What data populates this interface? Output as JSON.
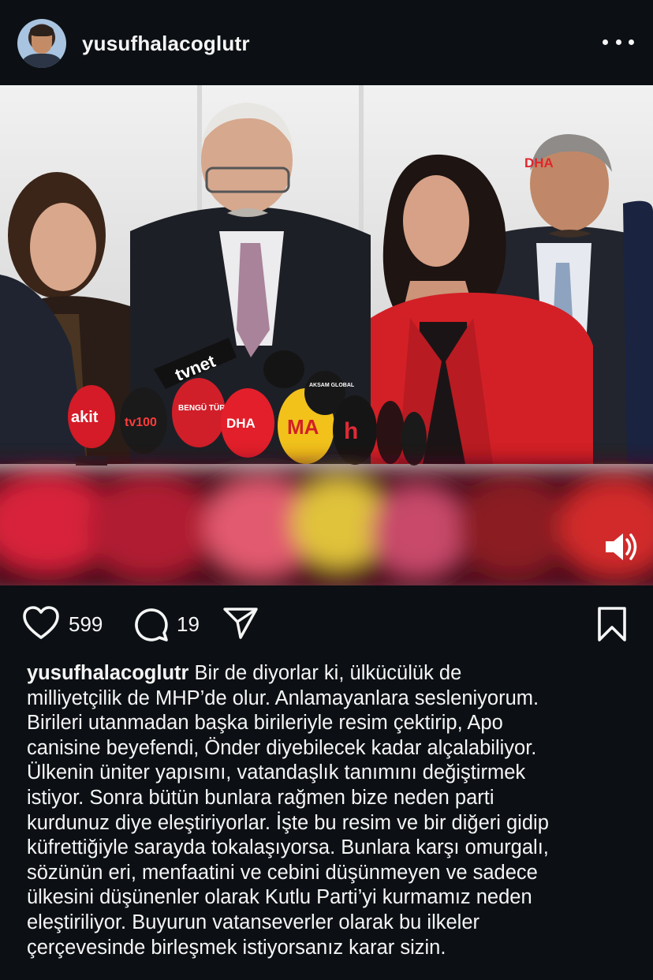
{
  "post": {
    "username": "yusufhalacoglutr",
    "likes": "599",
    "comments": "19"
  },
  "video": {
    "watermark": "DHA",
    "mic_labels": [
      "akit",
      "tv100",
      "BENGÜ TÜRK",
      "DHA",
      "MA",
      "tvnet",
      "AKSAM GLOBAL",
      "h"
    ]
  },
  "caption": {
    "username": "yusufhalacoglutr",
    "lines": [
      " Bir de diyorlar ki, ülkücülük de",
      "milliyetçilik de MHP’de olur. Anlamayanlara sesleniyorum.",
      "Birileri utanmadan başka birileriyle resim çektirip, Apo",
      "canisine beyefendi, Önder diyebilecek kadar alçalabiliyor.",
      "Ülkenin üniter yapısını, vatandaşlık tanımını değiştirmek",
      "istiyor. Sonra bütün bunlara rağmen bize neden parti",
      "kurdunuz diye eleştiriyorlar. İşte bu resim ve bir diğeri gidip",
      "küfrettiğiyle sarayda tokalaşıyorsa. Bunlara karşı omurgalı,",
      "sözünün eri, menfaatini ve cebini düşünmeyen ve sadece",
      "ülkesini düşünenler olarak Kutlu Parti’yi kurmamız neden",
      "eleştiriliyor. Buyurun vatanseverler olarak bu ilkeler",
      "çerçevesinde birleşmek istiyorsanız karar sizin."
    ]
  },
  "icons": [
    "more-icon",
    "heart-icon",
    "comment-icon",
    "share-icon",
    "bookmark-icon",
    "mute-icon"
  ],
  "colors": {
    "background": "#0c1014",
    "text": "#f5f5f5",
    "jacket_red": "#d32026"
  }
}
